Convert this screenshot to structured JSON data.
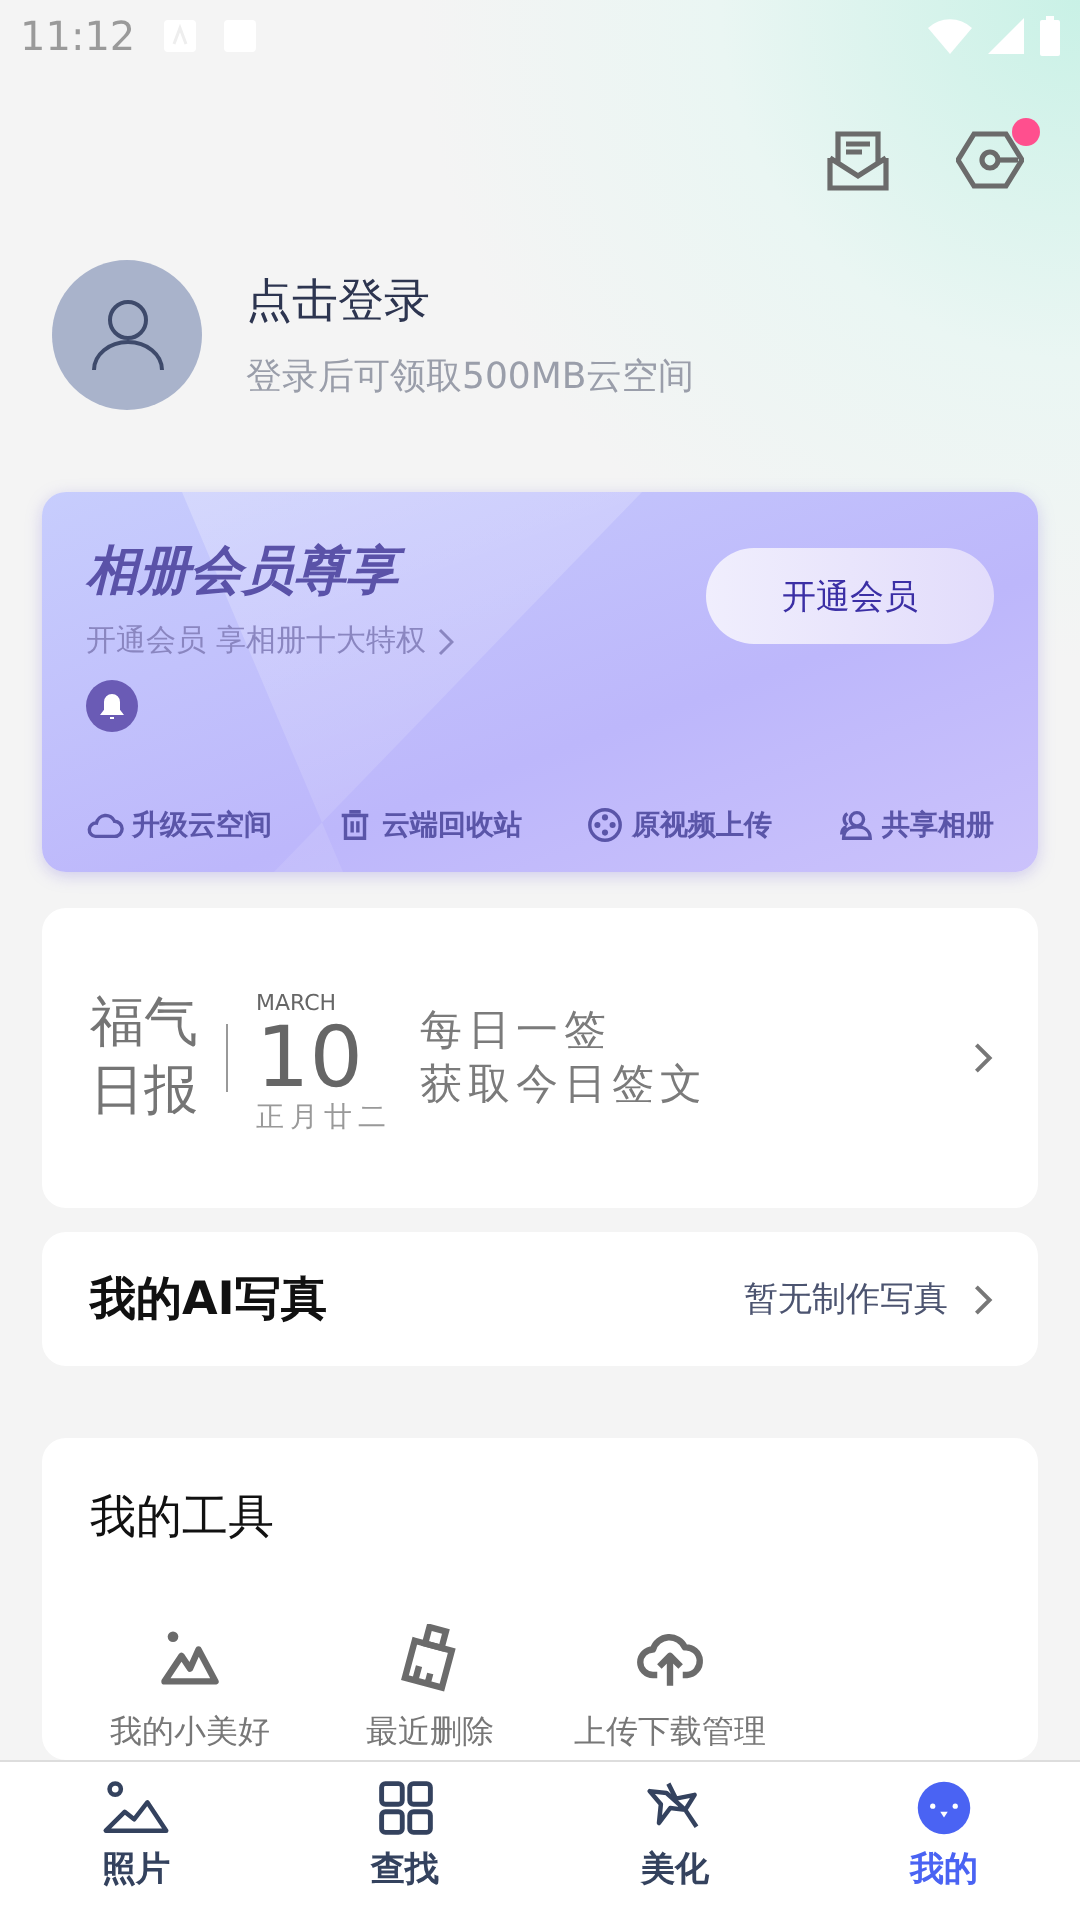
{
  "status_bar": {
    "time": "11:12"
  },
  "header": {
    "notification_dot": true
  },
  "profile": {
    "title": "点击登录",
    "subtitle": "登录后可领取500MB云空间"
  },
  "vip": {
    "title": "相册会员尊享",
    "subtitle": "开通会员 享相册十大特权",
    "button": "开通会员",
    "perks": [
      {
        "kind": "cloud",
        "label": "升级云空间"
      },
      {
        "kind": "trash",
        "label": "云端回收站"
      },
      {
        "kind": "film",
        "label": "原视频上传"
      },
      {
        "kind": "people",
        "label": "共享相册"
      }
    ]
  },
  "daily": {
    "title_line1": "福气",
    "title_line2": "日报",
    "month": "MARCH",
    "day": "10",
    "lunar": "正月廿二",
    "line1": "每日一签",
    "line2": "获取今日签文"
  },
  "ai_photo": {
    "title": "我的AI写真",
    "status": "暂无制作写真"
  },
  "tools": {
    "title": "我的工具",
    "items": [
      {
        "kind": "mountain",
        "label": "我的小美好"
      },
      {
        "kind": "broom",
        "label": "最近删除"
      },
      {
        "kind": "upload",
        "label": "上传下载管理"
      }
    ]
  },
  "tabs": [
    {
      "kind": "photos",
      "label": "照片",
      "selected": false
    },
    {
      "kind": "find",
      "label": "查找",
      "selected": false
    },
    {
      "kind": "beautify",
      "label": "美化",
      "selected": false
    },
    {
      "kind": "me",
      "label": "我的",
      "selected": true
    }
  ]
}
